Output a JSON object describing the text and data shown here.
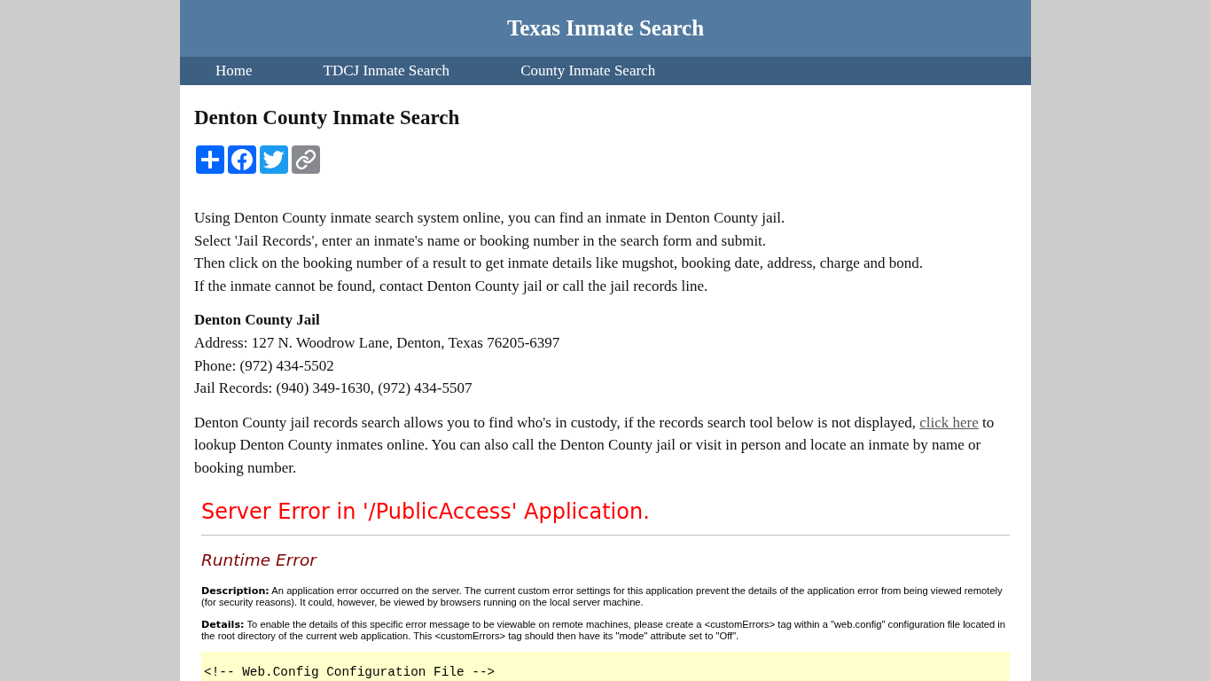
{
  "site_header": {
    "title": "Texas Inmate Search"
  },
  "nav": {
    "items": [
      {
        "label": "Home"
      },
      {
        "label": "TDCJ Inmate Search"
      },
      {
        "label": "County Inmate Search"
      }
    ]
  },
  "article": {
    "heading": "Denton County Inmate Search",
    "share_buttons": [
      {
        "kind": "share"
      },
      {
        "kind": "facebook"
      },
      {
        "kind": "twitter"
      },
      {
        "kind": "copy_link"
      }
    ],
    "intro_lines": [
      "Using Denton County inmate search system online, you can find an inmate in Denton County jail.",
      "Select 'Jail Records', enter an inmate's name or booking number in the search form and submit.",
      "Then click on the booking number of a result to get inmate details like mugshot, booking date, address, charge and bond.",
      "If the inmate cannot be found, contact Denton County jail or call the jail records line."
    ],
    "jail": {
      "name": "Denton County Jail",
      "lines": [
        "Address: 127 N. Woodrow Lane, Denton, Texas 76205-6397",
        "Phone: (972) 434-5502",
        "Jail Records: (940) 349-1630, (972) 434-5507"
      ]
    },
    "search_note": {
      "before": "Denton County jail records search allows you to find who's in custody, if the records search tool below is not displayed,",
      "link": "click here",
      "after": "to lookup Denton County inmates online. You can also call the Denton County jail or visit in person and locate an inmate by name or booking number."
    }
  },
  "embedded_page": {
    "title": "Server Error in '/PublicAccess' Application.",
    "error_type": "Runtime Error",
    "sections": [
      "**Description:** An application error occurred on the server. The current custom error settings for this application prevent the details of the application error from being viewed remotely (for security reasons). It could, however, be viewed by browsers running on the local server machine.",
      "**Details:** To enable the details of this specific error message to be viewable on remote machines, please create a <customErrors> tag within a \"web.config\" configuration file located in the root directory of the current web application. This <customErrors> tag should then have its \"mode\" attribute set to \"Off\"."
    ],
    "code_lines": [
      "<!-- Web.Config Configuration File -->"
    ]
  }
}
